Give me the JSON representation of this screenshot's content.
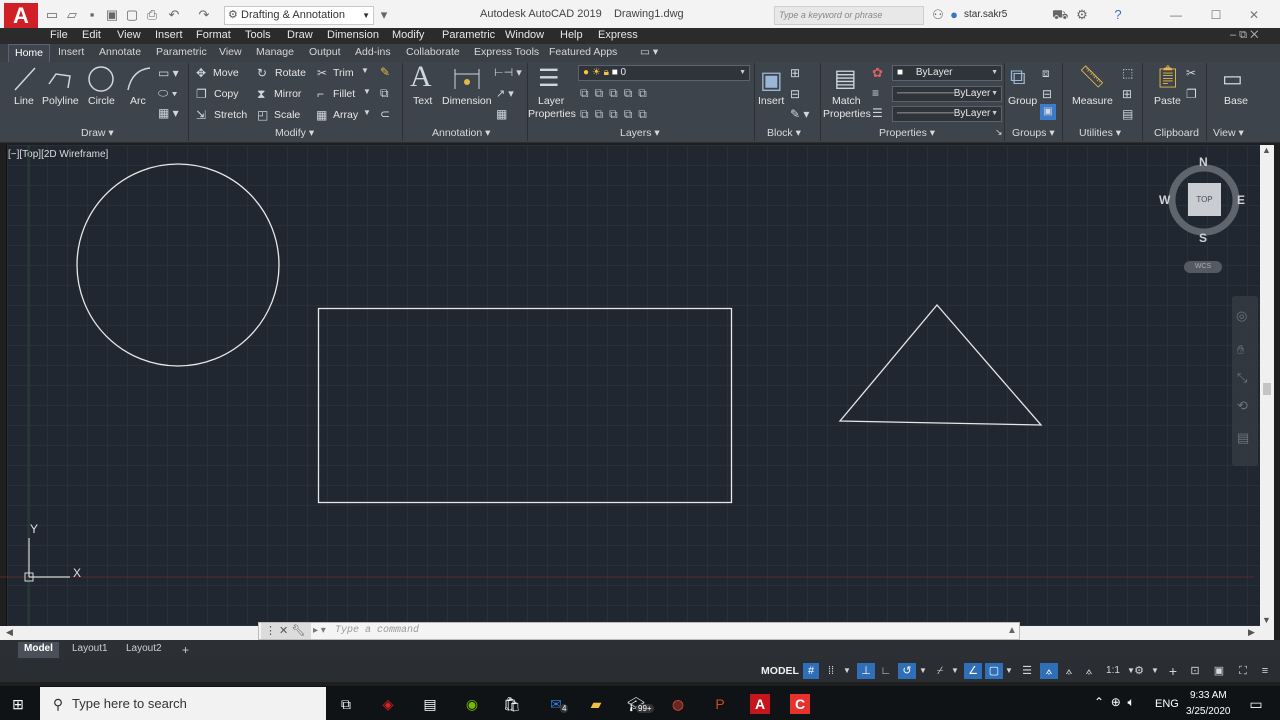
{
  "titlebar": {
    "logo": "A",
    "workspace": "Drafting & Annotation",
    "app_title": "Autodesk AutoCAD 2019",
    "file_name": "Drawing1.dwg",
    "search_placeholder": "Type a keyword or phrase",
    "user": "star.sakr5"
  },
  "menubar": [
    "File",
    "Edit",
    "View",
    "Insert",
    "Format",
    "Tools",
    "Draw",
    "Dimension",
    "Modify",
    "Parametric",
    "Window",
    "Help",
    "Express"
  ],
  "ribbon_tabs": [
    "Home",
    "Insert",
    "Annotate",
    "Parametric",
    "View",
    "Manage",
    "Output",
    "Add-ins",
    "Collaborate",
    "Express Tools",
    "Featured Apps"
  ],
  "ribbon": {
    "draw": {
      "line": "Line",
      "polyline": "Polyline",
      "circle": "Circle",
      "arc": "Arc",
      "footer": "Draw ▾"
    },
    "modify": {
      "move": "Move",
      "rotate": "Rotate",
      "trim": "Trim",
      "copy": "Copy",
      "mirror": "Mirror",
      "fillet": "Fillet",
      "stretch": "Stretch",
      "scale": "Scale",
      "array": "Array",
      "footer": "Modify ▾"
    },
    "annotation": {
      "text": "Text",
      "dimension": "Dimension",
      "footer": "Annotation ▾"
    },
    "layers": {
      "layer_properties_1": "Layer",
      "layer_properties_2": "Properties",
      "current_layer": "0",
      "footer": "Layers ▾"
    },
    "block": {
      "insert": "Insert",
      "footer": "Block ▾"
    },
    "properties": {
      "match_1": "Match",
      "match_2": "Properties",
      "color": "ByLayer",
      "linetype": "ByLayer",
      "lineweight": "ByLayer",
      "footer": "Properties ▾"
    },
    "groups": {
      "group": "Group",
      "footer": "Groups ▾"
    },
    "utilities": {
      "measure": "Measure",
      "footer": "Utilities ▾"
    },
    "clipboard": {
      "paste": "Paste",
      "footer": "Clipboard"
    },
    "view": {
      "base": "Base",
      "footer": "View ▾"
    }
  },
  "viewport": {
    "label": "[−][Top][2D Wireframe]"
  },
  "viewcube": {
    "north": "N",
    "south": "S",
    "east": "E",
    "west": "W",
    "face": "TOP",
    "wcs": "WCS"
  },
  "ucs": {
    "x": "X",
    "y": "Y"
  },
  "command_line": {
    "placeholder": "Type a command"
  },
  "layout_tabs": [
    "Model",
    "Layout1",
    "Layout2"
  ],
  "statusbar": {
    "model": "MODEL",
    "scale": "1:1"
  },
  "taskbar": {
    "search_placeholder": "Type here to search",
    "language": "ENG",
    "time": "9:33 AM",
    "date": "3/25/2020",
    "mail_badge": "4",
    "notif_badge": "99+"
  }
}
